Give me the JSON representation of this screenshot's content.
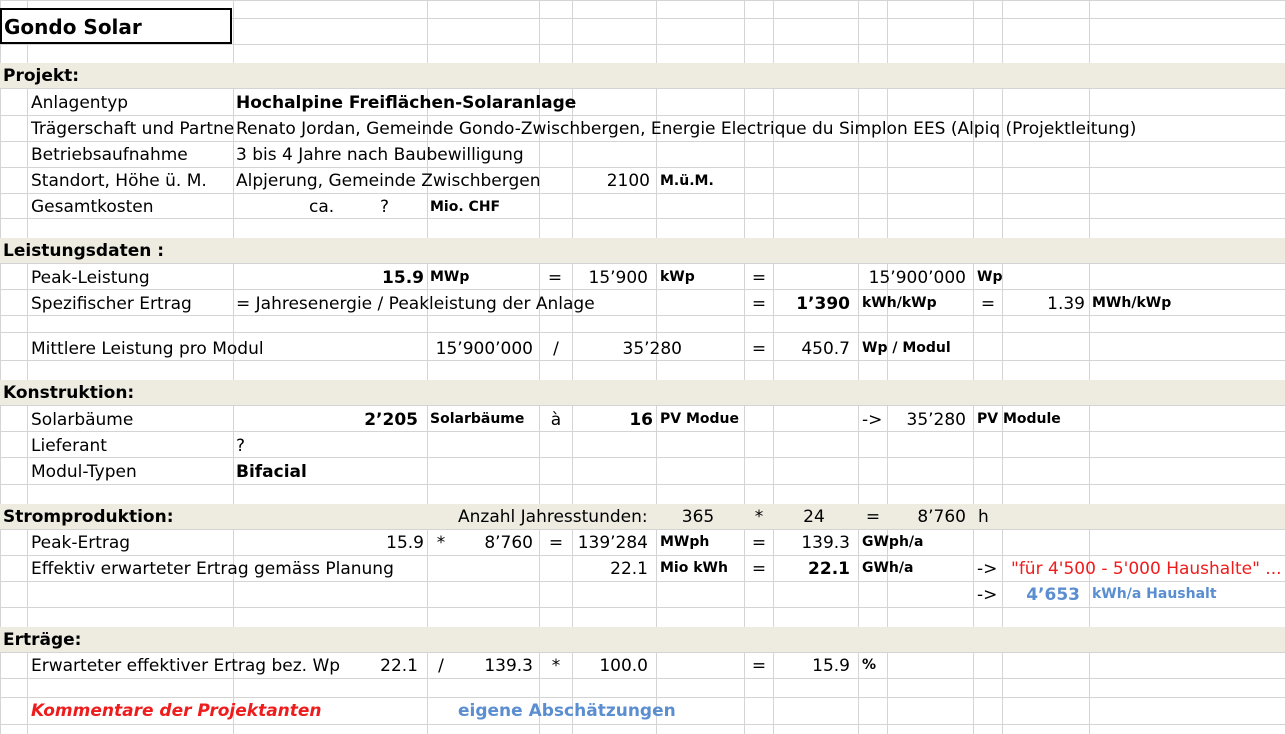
{
  "title": "Gondo Solar",
  "sections": {
    "projekt": "Projekt:",
    "leistung": "Leistungsdaten :",
    "konstruktion": "Konstruktion:",
    "strom": "Stromproduktion:",
    "ertraege": "Erträge:"
  },
  "projekt": {
    "anlagentyp_label": "Anlagentyp",
    "anlagentyp_value": "Hochalpine Freiflächen-Solaranlage",
    "traeger_label": "Trägerschaft und Partne",
    "traeger_value": "Renato Jordan,   Gemeinde Gondo-Zwischbergen,   Energie Electrique du Simplon EES  (Alpiq (Projektleitung)",
    "betrieb_label": "Betriebsaufnahme",
    "betrieb_value": "3 bis 4 Jahre nach Baubewilligung",
    "standort_label": "Standort,  Höhe ü. M.",
    "standort_value": "Alpjerung,  Gemeinde Zwischbergen",
    "hoehe_value": "2100",
    "hoehe_unit": "M.ü.M.",
    "kosten_label": "Gesamtkosten",
    "kosten_ca": "ca.",
    "kosten_value": "?",
    "kosten_unit": "Mio.  CHF"
  },
  "leistung": {
    "peak_label": "Peak-Leistung",
    "peak_mwp": "15.9",
    "peak_mwp_unit": "MWp",
    "eq1": "=",
    "peak_kwp": "15’900",
    "peak_kwp_unit": "kWp",
    "eq2": "=",
    "peak_wp": "15’900’000",
    "peak_wp_unit": "Wp",
    "spez_label": "Spezifischer Ertrag",
    "spez_formula": "=  Jahresenergie / Peakleistung der Anlage",
    "eq3": "=",
    "spez_value": "1’390",
    "spez_unit": "kWh/kWp",
    "eq4": "=",
    "spez_mwh": "1.39",
    "spez_mwh_unit": "MWh/kWp",
    "mittel_label": "Mittlere Leistung pro Modul",
    "mittel_wp": "15’900’000",
    "slash": "/",
    "mittel_modules": "35’280",
    "eq5": "=",
    "mittel_value": "450.7",
    "mittel_unit": "Wp / Modul"
  },
  "konstruktion": {
    "baeume_label": "Solarbäume",
    "baeume_value": "2’205",
    "baeume_unit": "Solarbäume",
    "a_sign": "à",
    "module_per": "16",
    "module_unit": "PV Modue",
    "arrow": "->",
    "module_total": "35’280",
    "module_total_unit": "PV Module",
    "lieferant_label": "Lieferant",
    "lieferant_value": "?",
    "typ_label": "Modul-Typen",
    "typ_value": "Bifacial"
  },
  "strom": {
    "jahres_label": "Anzahl Jahresstunden:",
    "days": "365",
    "times": "*",
    "hours": "24",
    "eq": "=",
    "total_hours": "8’760",
    "h_unit": "h",
    "peak_label": "Peak-Ertrag",
    "peak_mw": "15.9",
    "peak_times": "*",
    "peak_hours": "8’760",
    "peak_eq": "=",
    "peak_mwph": "139’284",
    "peak_mwph_unit": "MWph",
    "peak_eq2": "=",
    "peak_gwph": "139.3",
    "peak_gwph_unit": "GWph/a",
    "eff_label": "Effektiv erwarteter Ertrag  gemäss Planung",
    "eff_mio": "22.1",
    "eff_mio_unit": "Mio kWh",
    "eff_eq": "=",
    "eff_gwh": "22.1",
    "eff_gwh_unit": "GWh/a",
    "arrow1": "->",
    "haushalte_quote": "\"für 4'500 - 5'000 Haushalte\" ...",
    "arrow2": "->",
    "haushalt_value": "4’653",
    "haushalt_unit": "kWh/a Haushalt"
  },
  "ertraege": {
    "label": "Erwarteter effektiver Ertrag bez. Wp",
    "v1": "22.1",
    "slash": "/",
    "v2": "139.3",
    "times": "*",
    "v3": "100.0",
    "eq": "=",
    "result": "15.9",
    "unit": "%"
  },
  "legend": {
    "kommentare": "Kommentare der Projektanten",
    "eigene": "eigene Abschätzungen"
  },
  "colors": {
    "section_band": "#eeece1",
    "grid": "#d4d4d4",
    "comment_red": "#ee1c1c",
    "estimate_blue": "#5a8ed0"
  }
}
